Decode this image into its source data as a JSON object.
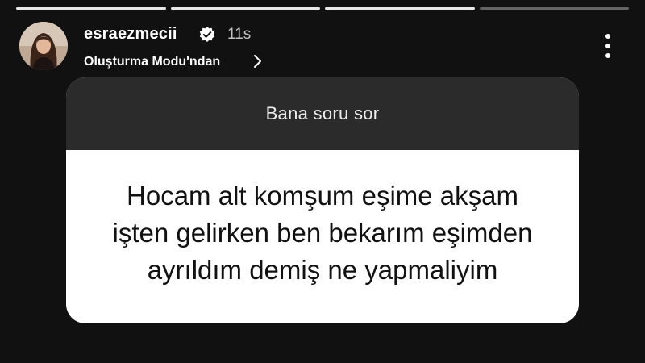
{
  "story": {
    "segments_total": 4,
    "segments_done": 3,
    "current_progress": 0.0
  },
  "header": {
    "username": "esraezmecii",
    "verified": true,
    "time_ago": "11s",
    "source_label": "Oluşturma Modu'ndan",
    "avatar_icon": "profile-photo",
    "verified_icon": "verified-badge-icon",
    "chevron_icon": "chevron-right-icon",
    "more_icon": "more-vertical-icon"
  },
  "question_card": {
    "prompt": "Bana soru sor",
    "question": "Hocam alt komşum eşime  akşam\nişten gelirken ben bekarım eşimden\nayrıldım demiş ne yapmaliyim",
    "header_bg": "#2b2b2b",
    "body_bg": "#ffffff"
  },
  "colors": {
    "background": "#111111",
    "text": "#ffffff"
  }
}
